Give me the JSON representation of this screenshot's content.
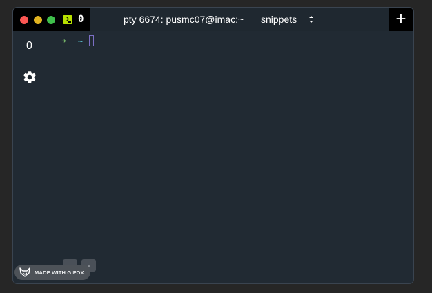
{
  "titlebar": {
    "tab_count": "0",
    "title": "pty 6674: pusmc07@imac:~",
    "snippets_label": "snippets",
    "add_tab_label": "+"
  },
  "sidebar": {
    "index_label": "0"
  },
  "terminal": {
    "prompt_arrow": "➜",
    "prompt_dir": "~"
  },
  "controls": {
    "plus_label": "+",
    "minus_label": "-"
  },
  "watermark": {
    "text": "MADE WITH GIFOX"
  },
  "colors": {
    "background": "#212a33",
    "prompt_arrow": "#7ec16e",
    "prompt_dir": "#56b6c2",
    "cursor": "#7c6fc4",
    "tab_icon": "#b8e000"
  }
}
